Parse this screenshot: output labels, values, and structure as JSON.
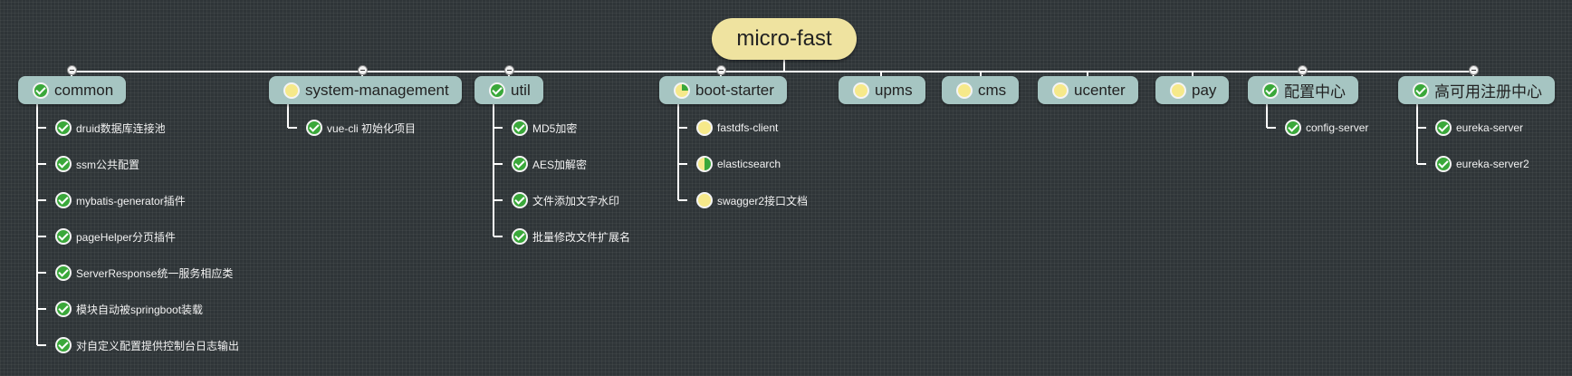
{
  "root": {
    "label": "micro-fast"
  },
  "icons": {
    "check": "checkmark-complete-icon",
    "empty": "task-not-started-icon",
    "quarter": "task-quarter-progress-icon",
    "half": "task-half-progress-icon"
  },
  "colors": {
    "background": "#2f3538",
    "root_fill": "#efe3a0",
    "branch_fill": "#a6c5c2",
    "connector": "#ffffff",
    "check_green": "#3aa83a",
    "progress_yellow": "#f6e98a"
  },
  "branches": [
    {
      "label": "common",
      "icon": "check",
      "collapsible": true,
      "children": [
        {
          "label": "druid数据库连接池",
          "icon": "check"
        },
        {
          "label": "ssm公共配置",
          "icon": "check"
        },
        {
          "label": "mybatis-generator插件",
          "icon": "check"
        },
        {
          "label": "pageHelper分页插件",
          "icon": "check"
        },
        {
          "label": "ServerResponse统一服务相应类",
          "icon": "check"
        },
        {
          "label": "模块自动被springboot装载",
          "icon": "check"
        },
        {
          "label": "对自定义配置提供控制台日志输出",
          "icon": "check"
        }
      ]
    },
    {
      "label": "system-management",
      "icon": "empty",
      "collapsible": true,
      "children": [
        {
          "label": "vue-cli 初始化项目",
          "icon": "check"
        }
      ]
    },
    {
      "label": "util",
      "icon": "check",
      "collapsible": true,
      "children": [
        {
          "label": "MD5加密",
          "icon": "check"
        },
        {
          "label": "AES加解密",
          "icon": "check"
        },
        {
          "label": "文件添加文字水印",
          "icon": "check"
        },
        {
          "label": "批量修改文件扩展名",
          "icon": "check"
        }
      ]
    },
    {
      "label": "boot-starter",
      "icon": "quarter",
      "collapsible": true,
      "children": [
        {
          "label": "fastdfs-client",
          "icon": "empty"
        },
        {
          "label": "elasticsearch",
          "icon": "half"
        },
        {
          "label": "swagger2接口文档",
          "icon": "empty"
        }
      ]
    },
    {
      "label": "upms",
      "icon": "empty",
      "collapsible": false,
      "children": []
    },
    {
      "label": "cms",
      "icon": "empty",
      "collapsible": false,
      "children": []
    },
    {
      "label": "ucenter",
      "icon": "empty",
      "collapsible": false,
      "children": []
    },
    {
      "label": "pay",
      "icon": "empty",
      "collapsible": false,
      "children": []
    },
    {
      "label": "配置中心",
      "icon": "check",
      "collapsible": true,
      "children": [
        {
          "label": "config-server",
          "icon": "check"
        }
      ]
    },
    {
      "label": "高可用注册中心",
      "icon": "check",
      "collapsible": true,
      "children": [
        {
          "label": "eureka-server",
          "icon": "check"
        },
        {
          "label": "eureka-server2",
          "icon": "check"
        }
      ]
    }
  ]
}
